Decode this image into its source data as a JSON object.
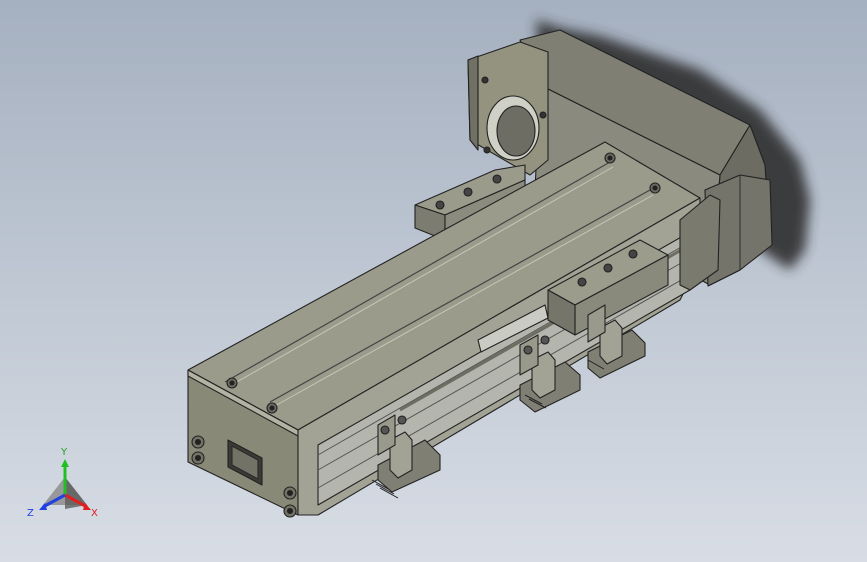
{
  "viewport": {
    "model": "linear-actuator-stepper",
    "background_top": "#a5b0c0",
    "background_bottom": "#d8dde5",
    "body_color": "#8c8c80",
    "shadow_color": "#3a3a3a"
  },
  "triad": {
    "x_label": "X",
    "y_label": "Y",
    "z_label": "Z",
    "x_color": "#e02020",
    "y_color": "#20c020",
    "z_color": "#2040e0"
  }
}
